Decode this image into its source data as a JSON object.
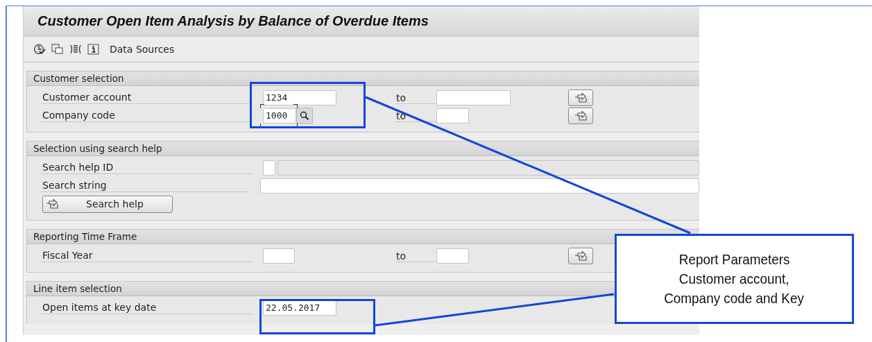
{
  "window": {
    "title": "Customer Open Item Analysis by Balance of Overdue Items"
  },
  "toolbar": {
    "label": "Data Sources"
  },
  "sections": [
    {
      "title": "Customer selection",
      "rows": [
        {
          "kind": "range",
          "label": "Customer account",
          "value": "1234",
          "to_label": "to",
          "focused": false,
          "value_help": false
        },
        {
          "kind": "range",
          "label": "Company code",
          "value": "1000",
          "to_label": "to",
          "focused": true,
          "value_help": true
        }
      ]
    },
    {
      "title": "Selection using search help",
      "rows": [
        {
          "kind": "searchhelp",
          "label": "Search help ID"
        },
        {
          "kind": "text",
          "label": "Search string"
        },
        {
          "kind": "button",
          "label": "Search help"
        }
      ]
    },
    {
      "title": "Reporting Time Frame",
      "rows": [
        {
          "kind": "range",
          "label": "Fiscal Year",
          "to_label": "to",
          "focused": false,
          "value_help": false
        }
      ]
    },
    {
      "title": "Line item selection",
      "rows": [
        {
          "kind": "single",
          "label": "Open items at key date",
          "value": "22.05.2017"
        }
      ]
    }
  ],
  "callout": {
    "lines": [
      "Report Parameters",
      "Customer account,",
      "Company code and Key"
    ]
  }
}
